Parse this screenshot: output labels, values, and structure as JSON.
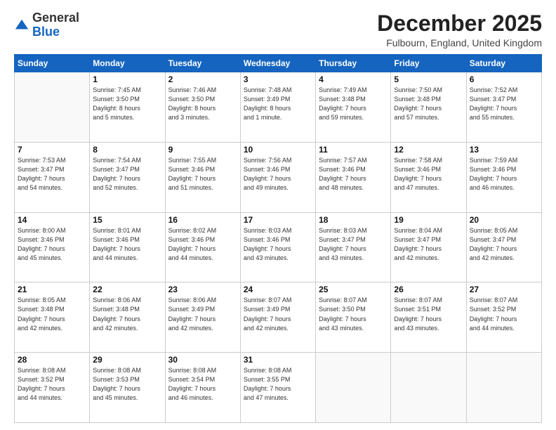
{
  "header": {
    "logo": {
      "line1": "General",
      "line2": "Blue"
    },
    "title": "December 2025",
    "location": "Fulbourn, England, United Kingdom"
  },
  "weekdays": [
    "Sunday",
    "Monday",
    "Tuesday",
    "Wednesday",
    "Thursday",
    "Friday",
    "Saturday"
  ],
  "weeks": [
    [
      {
        "day": "",
        "info": ""
      },
      {
        "day": "1",
        "info": "Sunrise: 7:45 AM\nSunset: 3:50 PM\nDaylight: 8 hours\nand 5 minutes."
      },
      {
        "day": "2",
        "info": "Sunrise: 7:46 AM\nSunset: 3:50 PM\nDaylight: 8 hours\nand 3 minutes."
      },
      {
        "day": "3",
        "info": "Sunrise: 7:48 AM\nSunset: 3:49 PM\nDaylight: 8 hours\nand 1 minute."
      },
      {
        "day": "4",
        "info": "Sunrise: 7:49 AM\nSunset: 3:48 PM\nDaylight: 7 hours\nand 59 minutes."
      },
      {
        "day": "5",
        "info": "Sunrise: 7:50 AM\nSunset: 3:48 PM\nDaylight: 7 hours\nand 57 minutes."
      },
      {
        "day": "6",
        "info": "Sunrise: 7:52 AM\nSunset: 3:47 PM\nDaylight: 7 hours\nand 55 minutes."
      }
    ],
    [
      {
        "day": "7",
        "info": "Sunrise: 7:53 AM\nSunset: 3:47 PM\nDaylight: 7 hours\nand 54 minutes."
      },
      {
        "day": "8",
        "info": "Sunrise: 7:54 AM\nSunset: 3:47 PM\nDaylight: 7 hours\nand 52 minutes."
      },
      {
        "day": "9",
        "info": "Sunrise: 7:55 AM\nSunset: 3:46 PM\nDaylight: 7 hours\nand 51 minutes."
      },
      {
        "day": "10",
        "info": "Sunrise: 7:56 AM\nSunset: 3:46 PM\nDaylight: 7 hours\nand 49 minutes."
      },
      {
        "day": "11",
        "info": "Sunrise: 7:57 AM\nSunset: 3:46 PM\nDaylight: 7 hours\nand 48 minutes."
      },
      {
        "day": "12",
        "info": "Sunrise: 7:58 AM\nSunset: 3:46 PM\nDaylight: 7 hours\nand 47 minutes."
      },
      {
        "day": "13",
        "info": "Sunrise: 7:59 AM\nSunset: 3:46 PM\nDaylight: 7 hours\nand 46 minutes."
      }
    ],
    [
      {
        "day": "14",
        "info": "Sunrise: 8:00 AM\nSunset: 3:46 PM\nDaylight: 7 hours\nand 45 minutes."
      },
      {
        "day": "15",
        "info": "Sunrise: 8:01 AM\nSunset: 3:46 PM\nDaylight: 7 hours\nand 44 minutes."
      },
      {
        "day": "16",
        "info": "Sunrise: 8:02 AM\nSunset: 3:46 PM\nDaylight: 7 hours\nand 44 minutes."
      },
      {
        "day": "17",
        "info": "Sunrise: 8:03 AM\nSunset: 3:46 PM\nDaylight: 7 hours\nand 43 minutes."
      },
      {
        "day": "18",
        "info": "Sunrise: 8:03 AM\nSunset: 3:47 PM\nDaylight: 7 hours\nand 43 minutes."
      },
      {
        "day": "19",
        "info": "Sunrise: 8:04 AM\nSunset: 3:47 PM\nDaylight: 7 hours\nand 42 minutes."
      },
      {
        "day": "20",
        "info": "Sunrise: 8:05 AM\nSunset: 3:47 PM\nDaylight: 7 hours\nand 42 minutes."
      }
    ],
    [
      {
        "day": "21",
        "info": "Sunrise: 8:05 AM\nSunset: 3:48 PM\nDaylight: 7 hours\nand 42 minutes."
      },
      {
        "day": "22",
        "info": "Sunrise: 8:06 AM\nSunset: 3:48 PM\nDaylight: 7 hours\nand 42 minutes."
      },
      {
        "day": "23",
        "info": "Sunrise: 8:06 AM\nSunset: 3:49 PM\nDaylight: 7 hours\nand 42 minutes."
      },
      {
        "day": "24",
        "info": "Sunrise: 8:07 AM\nSunset: 3:49 PM\nDaylight: 7 hours\nand 42 minutes."
      },
      {
        "day": "25",
        "info": "Sunrise: 8:07 AM\nSunset: 3:50 PM\nDaylight: 7 hours\nand 43 minutes."
      },
      {
        "day": "26",
        "info": "Sunrise: 8:07 AM\nSunset: 3:51 PM\nDaylight: 7 hours\nand 43 minutes."
      },
      {
        "day": "27",
        "info": "Sunrise: 8:07 AM\nSunset: 3:52 PM\nDaylight: 7 hours\nand 44 minutes."
      }
    ],
    [
      {
        "day": "28",
        "info": "Sunrise: 8:08 AM\nSunset: 3:52 PM\nDaylight: 7 hours\nand 44 minutes."
      },
      {
        "day": "29",
        "info": "Sunrise: 8:08 AM\nSunset: 3:53 PM\nDaylight: 7 hours\nand 45 minutes."
      },
      {
        "day": "30",
        "info": "Sunrise: 8:08 AM\nSunset: 3:54 PM\nDaylight: 7 hours\nand 46 minutes."
      },
      {
        "day": "31",
        "info": "Sunrise: 8:08 AM\nSunset: 3:55 PM\nDaylight: 7 hours\nand 47 minutes."
      },
      {
        "day": "",
        "info": ""
      },
      {
        "day": "",
        "info": ""
      },
      {
        "day": "",
        "info": ""
      }
    ]
  ]
}
